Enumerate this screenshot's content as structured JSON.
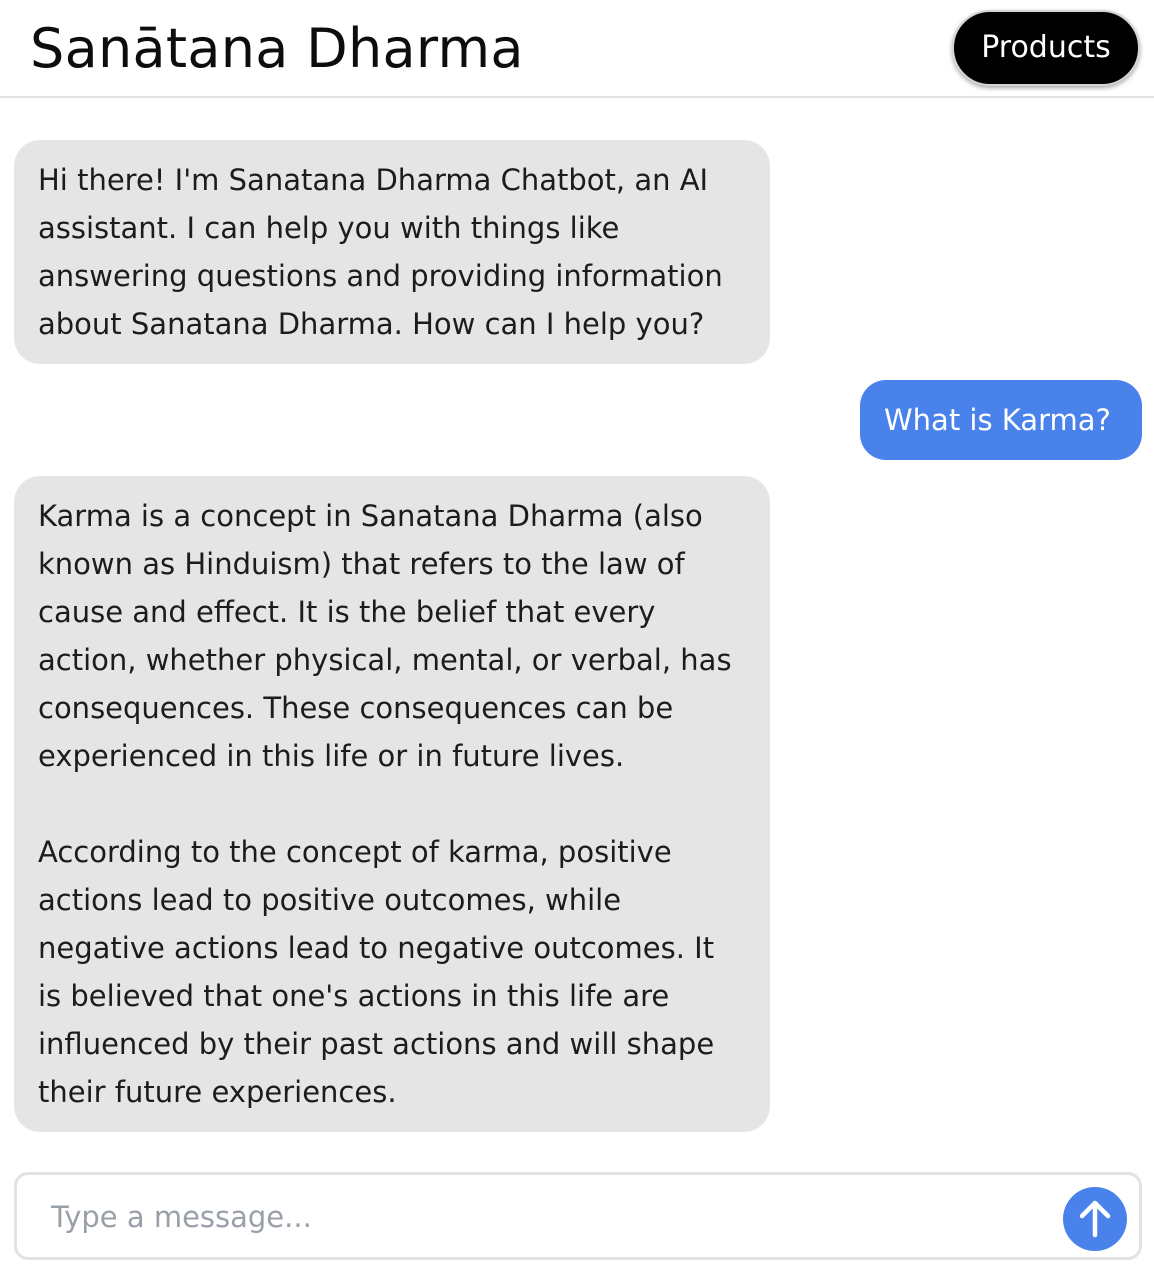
{
  "header": {
    "title": "Sanātana Dharma",
    "products_label": "Products"
  },
  "messages": [
    {
      "role": "bot",
      "text": "Hi there! I'm Sanatana Dharma Chatbot, an AI assistant. I can help you with things like answering questions and providing information about Sanatana Dharma. How can I help you?"
    },
    {
      "role": "user",
      "text": "What is Karma?"
    },
    {
      "role": "bot",
      "text": "Karma is a concept in Sanatana Dharma (also known as Hinduism) that refers to the law of cause and effect. It is the belief that every action, whether physical, mental, or verbal, has consequences. These consequences can be experienced in this life or in future lives.\n\nAccording to the concept of karma, positive actions lead to positive outcomes, while negative actions lead to negative outcomes. It is believed that one's actions in this life are influenced by their past actions and will shape their future experiences."
    }
  ],
  "composer": {
    "placeholder": "Type a message...",
    "value": "",
    "send_icon": "arrow-up-icon"
  },
  "colors": {
    "accent": "#4a82ec",
    "bot_bubble": "#e5e5e5",
    "products_button": "#000000"
  }
}
